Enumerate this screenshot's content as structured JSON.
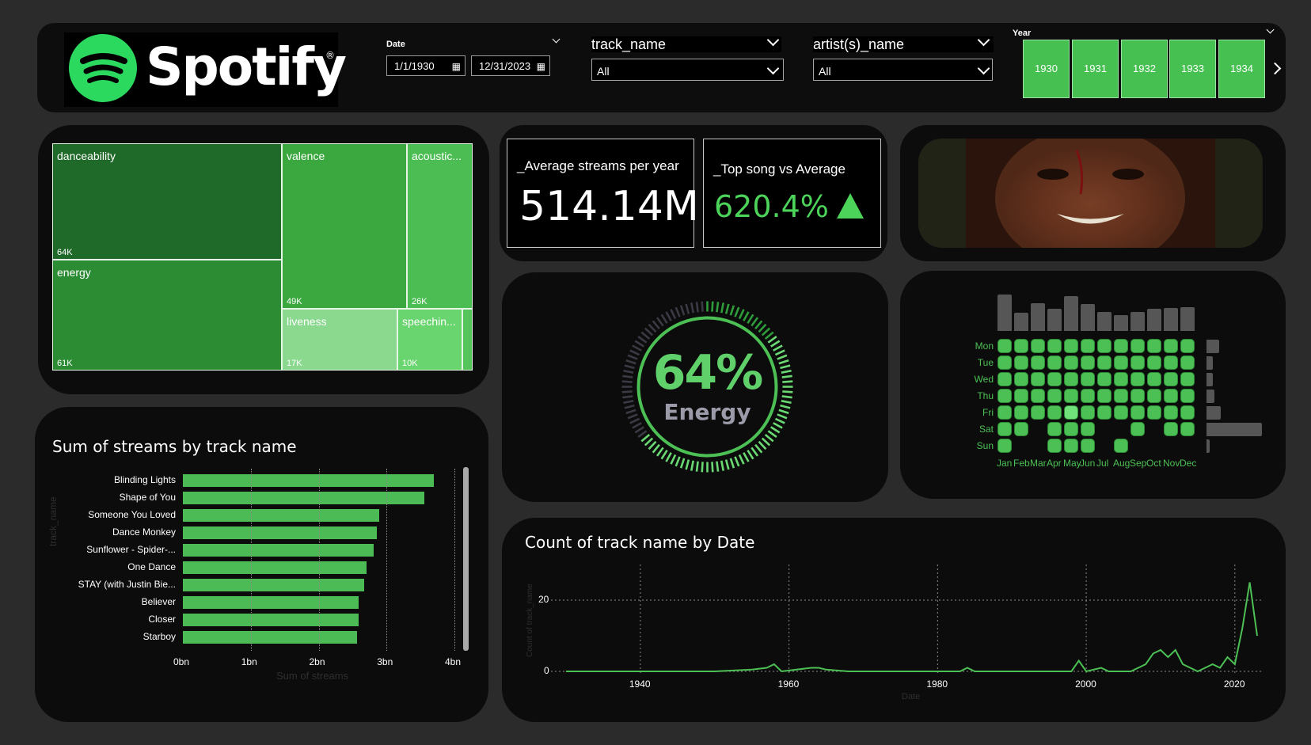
{
  "header": {
    "logo_text": "Spotify",
    "logo_reg": "®",
    "date_label": "Date",
    "date_start": "1/1/1930",
    "date_end": "12/31/2023",
    "track_slicer": {
      "title": "track_name",
      "value": "All"
    },
    "artist_slicer": {
      "title": "artist(s)_name",
      "value": "All"
    },
    "year_label": "Year",
    "years": [
      "1930",
      "1931",
      "1932",
      "1933",
      "1934"
    ]
  },
  "treemap": {
    "cells": [
      {
        "label": "danceability",
        "value": "64K"
      },
      {
        "label": "energy",
        "value": "61K"
      },
      {
        "label": "valence",
        "value": "49K"
      },
      {
        "label": "acoustic...",
        "value": "26K"
      },
      {
        "label": "liveness",
        "value": "17K"
      },
      {
        "label": "speechin...",
        "value": "10K"
      }
    ]
  },
  "kpi": {
    "avg_streams_title": "_Average streams per year",
    "avg_streams_value": "514.14M",
    "top_song_title": "_Top song vs Average",
    "top_song_value": "620.4%",
    "top_song_arrow": "triangle-up-icon"
  },
  "gauge": {
    "value": "64%",
    "label": "Energy",
    "fraction": 0.64
  },
  "bar_chart": {
    "title": "Sum of streams by track name",
    "x_title": "Sum of streams",
    "y_title": "track_name",
    "ticks": [
      "0bn",
      "1bn",
      "2bn",
      "3bn",
      "4bn"
    ]
  },
  "heatmap": {
    "days": [
      "Mon",
      "Tue",
      "Wed",
      "Thu",
      "Fri",
      "Sat",
      "Sun"
    ],
    "months": [
      "Jan",
      "Feb",
      "Mar",
      "Apr",
      "May",
      "Jun",
      "Jul",
      "Aug",
      "Sep",
      "Oct",
      "Nov",
      "Dec"
    ]
  },
  "line_chart": {
    "title": "Count of track name by Date",
    "x_title": "Date",
    "y_title": "Count of track_name",
    "x_ticks": [
      "1940",
      "1960",
      "1980",
      "2000",
      "2020"
    ],
    "y_ticks": [
      "0",
      "20"
    ]
  },
  "colors": {
    "accent": "#4cbb55",
    "brand": "#1ed760",
    "background": "#0c0c0c",
    "canvas": "#2b2b2b"
  },
  "chart_data": [
    {
      "type": "bar",
      "title": "Sum of streams by track name",
      "xlabel": "Sum of streams",
      "ylabel": "track_name",
      "xlim": [
        0,
        4000000000
      ],
      "categories": [
        "Blinding Lights",
        "Shape of You",
        "Someone You Loved",
        "Dance Monkey",
        "Sunflower - Spider-...",
        "One Dance",
        "STAY (with Justin Bie...",
        "Believer",
        "Closer",
        "Starboy"
      ],
      "values": [
        3700000000,
        3560000000,
        2890000000,
        2860000000,
        2810000000,
        2710000000,
        2670000000,
        2590000000,
        2590000000,
        2570000000
      ]
    },
    {
      "type": "line",
      "title": "Count of track name by Date",
      "xlabel": "Date",
      "ylabel": "Count of track_name",
      "xlim": [
        1930,
        2023
      ],
      "ylim": [
        0,
        25
      ],
      "x": [
        1930,
        1950,
        1955,
        1957,
        1958,
        1959,
        1963,
        1964,
        1965,
        1968,
        1983,
        1984,
        1985,
        1998,
        1999,
        2000,
        2002,
        2003,
        2004,
        2005,
        2006,
        2007,
        2008,
        2009,
        2010,
        2011,
        2012,
        2013,
        2014,
        2015,
        2016,
        2017,
        2018,
        2019,
        2020,
        2021,
        2022,
        2023
      ],
      "y": [
        0,
        0,
        0.5,
        1,
        2,
        0,
        1,
        1,
        0.5,
        0,
        0,
        1,
        0,
        0,
        3,
        0,
        1,
        0,
        0,
        0,
        0,
        1,
        2,
        5,
        6,
        4,
        6,
        2,
        1,
        0,
        1,
        2,
        1,
        4,
        2,
        12,
        25,
        10
      ]
    },
    {
      "type": "bar",
      "title": "",
      "categories": [
        "Jan",
        "Feb",
        "Mar",
        "Apr",
        "May",
        "Jun",
        "Jul",
        "Aug",
        "Sep",
        "Oct",
        "Nov",
        "Dec"
      ],
      "values": [
        46,
        23,
        35,
        28,
        44,
        34,
        24,
        20,
        24,
        28,
        29,
        30
      ]
    }
  ]
}
